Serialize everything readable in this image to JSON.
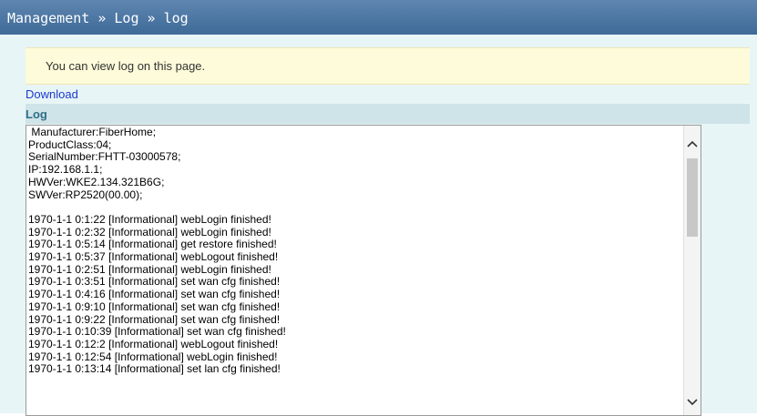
{
  "breadcrumb": {
    "text": "Management » Log » log"
  },
  "info": {
    "message": "You can view log on this page."
  },
  "download": {
    "label": "Download"
  },
  "log_section": {
    "title": "Log",
    "lines": [
      " Manufacturer:FiberHome;",
      "ProductClass:04;",
      "SerialNumber:FHTT-03000578;",
      "IP:192.168.1.1;",
      "HWVer:WKE2.134.321B6G;",
      "SWVer:RP2520(00.00);",
      "",
      "1970-1-1 0:1:22 [Informational] webLogin finished!",
      "1970-1-1 0:2:32 [Informational] webLogin finished!",
      "1970-1-1 0:5:14 [Informational] get restore finished!",
      "1970-1-1 0:5:37 [Informational] webLogout finished!",
      "1970-1-1 0:2:51 [Informational] webLogin finished!",
      "1970-1-1 0:3:51 [Informational] set wan cfg finished!",
      "1970-1-1 0:4:16 [Informational] set wan cfg finished!",
      "1970-1-1 0:9:10 [Informational] set wan cfg finished!",
      "1970-1-1 0:9:22 [Informational] set wan cfg finished!",
      "1970-1-1 0:10:39 [Informational] set wan cfg finished!",
      "1970-1-1 0:12:2 [Informational] webLogout finished!",
      "1970-1-1 0:12:54 [Informational] webLogin finished!",
      "1970-1-1 0:13:14 [Informational] set lan cfg finished!"
    ]
  },
  "icons": {
    "scroll_up": "chevron-up-icon",
    "scroll_down": "chevron-down-icon"
  },
  "colors": {
    "title_bar": "#4a76a3",
    "content_bg": "#e8f5f7",
    "info_bg": "#fdfbd9",
    "link": "#1a3acc",
    "section_title": "#2f6f8a"
  }
}
